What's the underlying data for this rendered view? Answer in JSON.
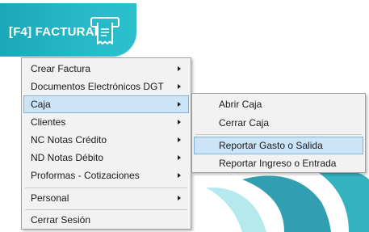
{
  "banner": {
    "label": "[F4] FACTURAR",
    "icon": "receipt-register-icon",
    "color": "#27b9c8"
  },
  "main_menu": {
    "items": [
      {
        "label": "Crear Factura",
        "has_submenu": true
      },
      {
        "label": "Documentos Electrónicos DGT",
        "has_submenu": true
      },
      {
        "label": "Caja",
        "has_submenu": true,
        "highlighted": true
      },
      {
        "label": "Clientes",
        "has_submenu": true
      },
      {
        "label": "NC Notas Crédito",
        "has_submenu": true
      },
      {
        "label": "ND Notas Débito",
        "has_submenu": true
      },
      {
        "label": "Proformas - Cotizaciones",
        "has_submenu": true
      },
      {
        "label": "Personal",
        "has_submenu": true
      },
      {
        "label": "Cerrar Sesión",
        "has_submenu": false
      }
    ]
  },
  "caja_submenu": {
    "items": [
      {
        "label": "Abrir Caja"
      },
      {
        "label": "Cerrar Caja"
      },
      {
        "label": "Reportar Gasto o Salida",
        "highlighted": true
      },
      {
        "label": "Reportar Ingreso o Entrada"
      }
    ]
  },
  "colors": {
    "highlight_fill": "#cce4f7",
    "highlight_border": "#7fb2dd",
    "menu_background": "#f2f2f2",
    "accent_teal": "#27b9c8"
  }
}
